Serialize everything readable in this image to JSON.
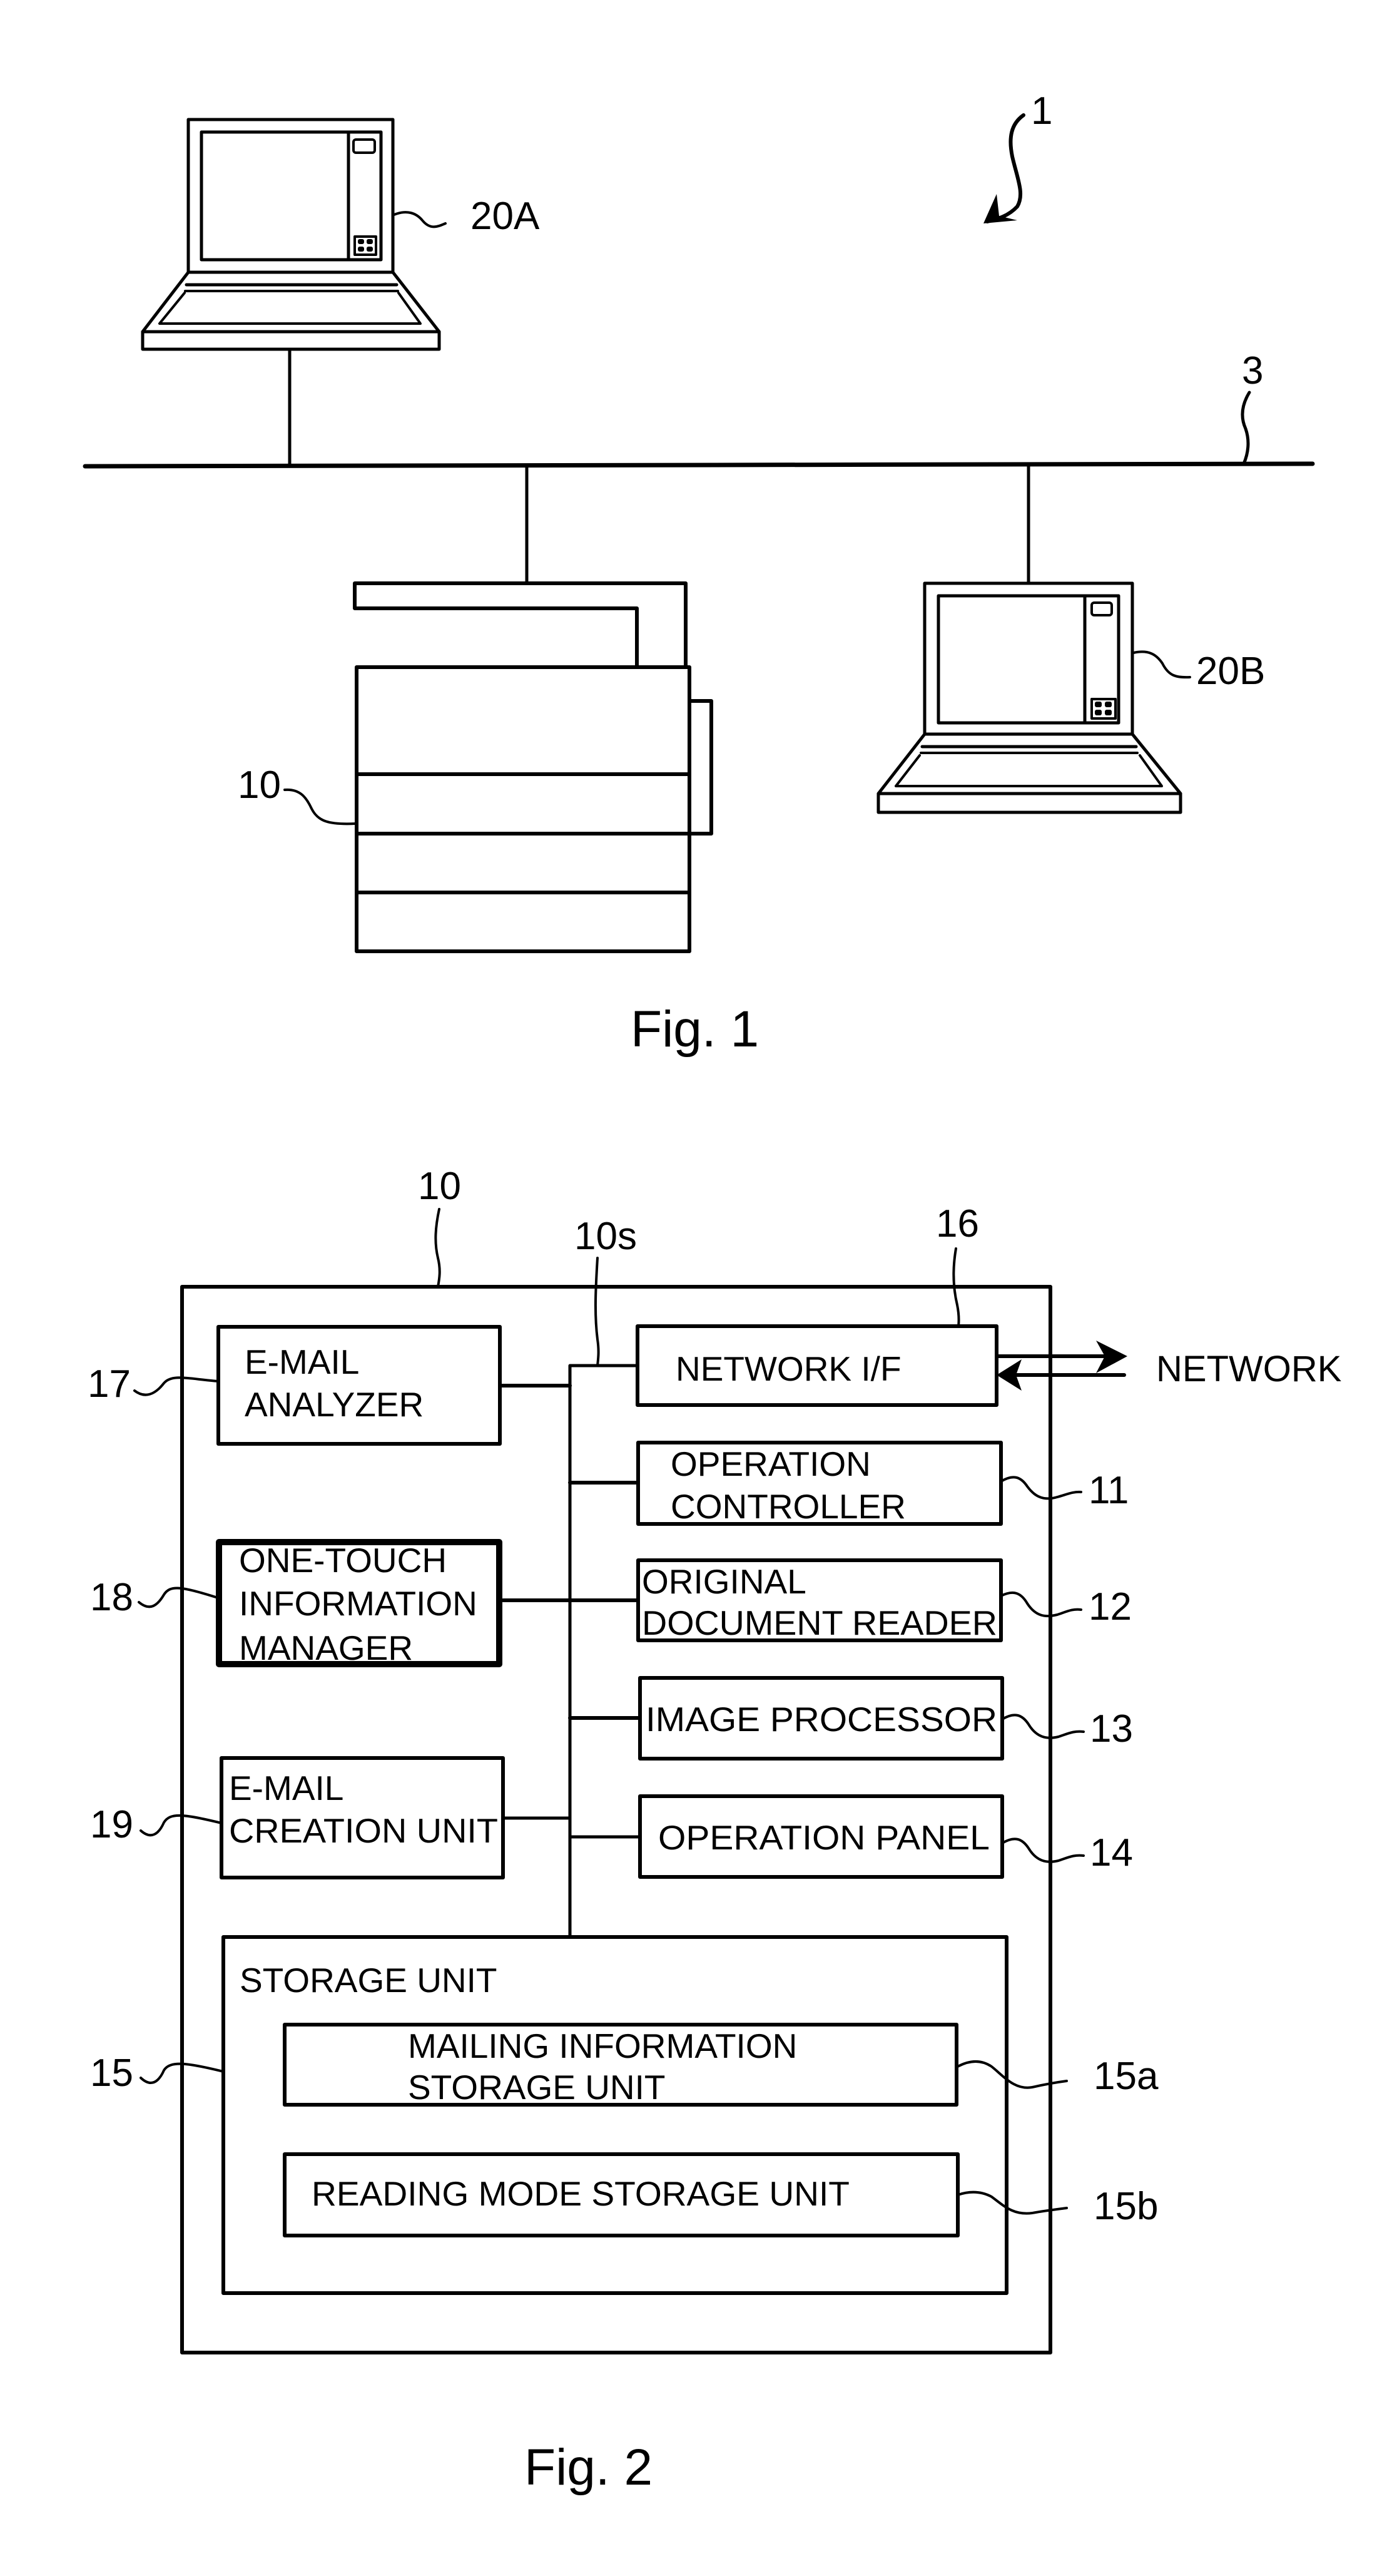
{
  "figure1": {
    "caption": "Fig. 1",
    "system_ref": "1",
    "network_ref": "3",
    "terminal_a_ref": "20A",
    "terminal_b_ref": "20B",
    "mfp_ref": "10"
  },
  "figure2": {
    "caption": "Fig. 2",
    "device_ref": "10",
    "bus_ref": "10s",
    "external_label": "NETWORK",
    "blocks": {
      "email_analyzer": {
        "ref": "17",
        "lines": [
          "E-MAIL",
          "ANALYZER"
        ]
      },
      "one_touch_manager": {
        "ref": "18",
        "lines": [
          "ONE-TOUCH",
          "INFORMATION",
          "MANAGER"
        ]
      },
      "email_creation": {
        "ref": "19",
        "lines": [
          "E-MAIL",
          "CREATION UNIT"
        ]
      },
      "network_if": {
        "ref": "16",
        "lines": [
          "NETWORK I/F"
        ]
      },
      "operation_controller": {
        "ref": "11",
        "lines": [
          "OPERATION",
          "CONTROLLER"
        ]
      },
      "document_reader": {
        "ref": "12",
        "lines": [
          "ORIGINAL",
          "DOCUMENT READER"
        ]
      },
      "image_processor": {
        "ref": "13",
        "lines": [
          "IMAGE PROCESSOR"
        ]
      },
      "operation_panel": {
        "ref": "14",
        "lines": [
          "OPERATION PANEL"
        ]
      },
      "storage_unit": {
        "ref": "15",
        "lines": [
          "STORAGE UNIT"
        ]
      },
      "mailing_info_storage": {
        "ref": "15a",
        "lines": [
          "MAILING INFORMATION",
          "STORAGE UNIT"
        ]
      },
      "reading_mode_storage": {
        "ref": "15b",
        "lines": [
          "READING MODE STORAGE UNIT"
        ]
      }
    }
  }
}
